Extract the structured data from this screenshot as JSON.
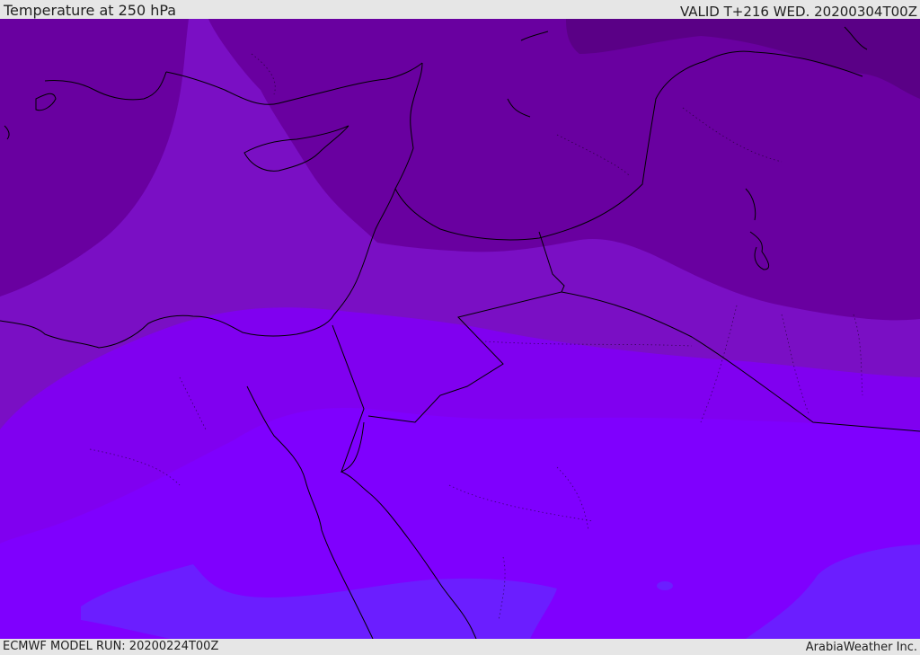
{
  "header": {
    "title": "Temperature at 250 hPa",
    "valid_time": "VALID T+216 WED. 20200304T00Z"
  },
  "footer": {
    "model_run": "ECMWF MODEL RUN: 20200224T00Z",
    "credit": "ArabiaWeather Inc."
  },
  "map": {
    "field": "temperature-250hPa",
    "colors": {
      "darkest": "#5c0088",
      "dark": "#6a009b",
      "mid": "#7610b6",
      "light": "#8400e6",
      "lightest": "#7f00fe",
      "pale": "#6b1eff",
      "coast": "#000000"
    }
  }
}
